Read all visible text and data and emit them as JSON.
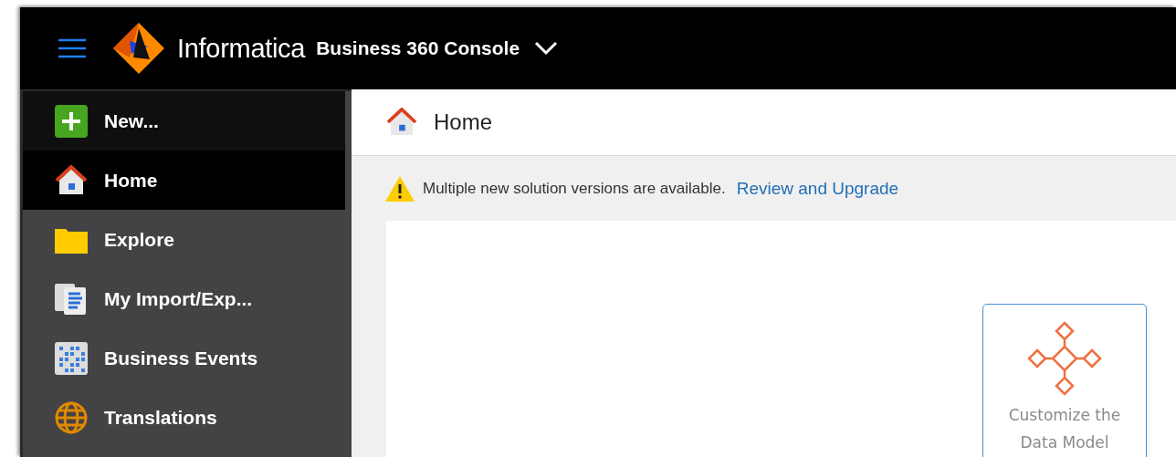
{
  "top_bar": {
    "brand": "Informatica",
    "product": "Business 360 Console"
  },
  "sidebar": {
    "items": [
      {
        "kind": "new",
        "label": "New...",
        "selected": false
      },
      {
        "kind": "home",
        "label": "Home",
        "selected": true
      },
      {
        "kind": "folder",
        "label": "Explore",
        "selected": false
      },
      {
        "kind": "documents",
        "label": "My Import/Exp...",
        "selected": false
      },
      {
        "kind": "events",
        "label": "Business Events",
        "selected": false
      },
      {
        "kind": "globe",
        "label": "Translations",
        "selected": false
      }
    ]
  },
  "page_header": {
    "title": "Home"
  },
  "notice": {
    "message": "Multiple new solution versions are available.",
    "link": "Review and Upgrade"
  },
  "cards": [
    {
      "label": "Customize the Data Model"
    }
  ]
}
